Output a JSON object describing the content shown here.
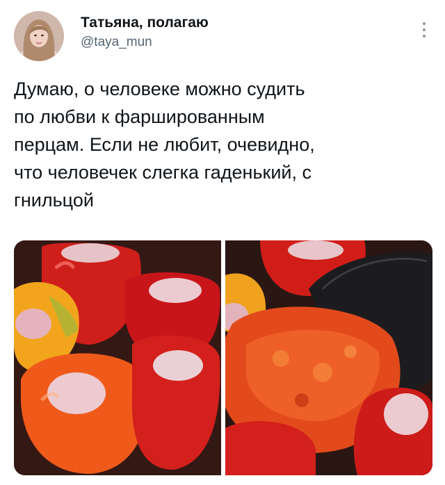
{
  "tweet": {
    "author": {
      "display_name": "Татьяна, полагаю",
      "handle": "@taya_mun"
    },
    "more_icon": "more-vertical-icon",
    "text": "Думаю, о человеке можно судить\nпо любви к фаршированным\nперцам. Если не любит, очевидно,\nчто человечек слегка гаденький, с\nгнильцой",
    "media": [
      {
        "subject": "stuffed-peppers-in-pot"
      },
      {
        "subject": "tomato-sauce-on-spoon"
      }
    ]
  },
  "colors": {
    "text": "#0f1419",
    "secondary": "#536471",
    "pepper_red": "#d4201c",
    "pepper_orange": "#ef5a1a",
    "pepper_yellow": "#f2a51c",
    "rice": "#e9c9cc"
  }
}
